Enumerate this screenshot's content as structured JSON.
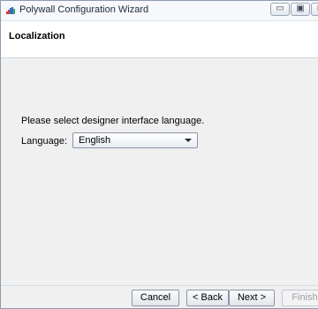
{
  "window": {
    "title": "Polywall Configuration Wizard",
    "controls": {
      "minimize": "▭",
      "maximize": "▣",
      "close": "⊠"
    },
    "icon_colors": [
      "#d9353f",
      "#d9353f",
      "#2a6fd1",
      "#2a6fd1",
      "#37a84b"
    ]
  },
  "header": {
    "title": "Localization"
  },
  "main": {
    "prompt": "Please select designer interface language.",
    "language_label": "Language:",
    "language_value": "English"
  },
  "footer": {
    "cancel": "Cancel",
    "back": "< Back",
    "next": "Next >",
    "finish": "Finish"
  }
}
